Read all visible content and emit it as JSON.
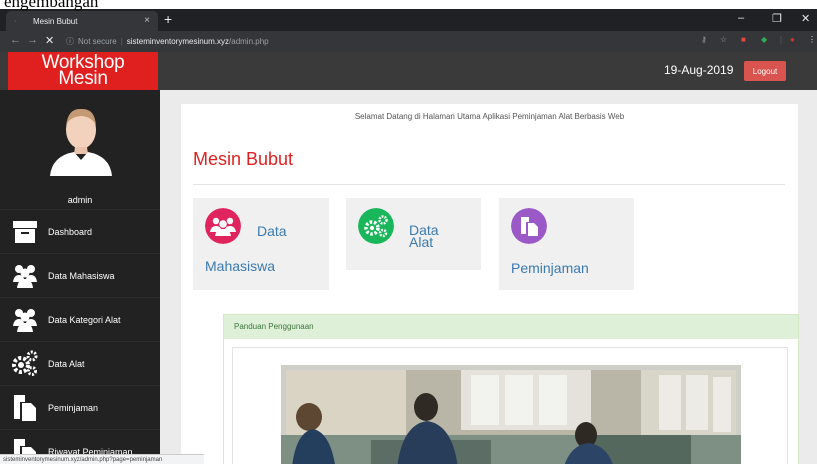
{
  "caption": "engembangan",
  "browser": {
    "tab_title": "Mesin Bubut",
    "tab_close": "×",
    "new_tab": "+",
    "security": "Not secure",
    "url_host": "sisteminventorymesinum.xyz",
    "url_path": "/admin.php"
  },
  "header": {
    "brand_line1": "Workshop",
    "brand_line2": "Mesin",
    "date": "19-Aug-2019",
    "logout": "Logout"
  },
  "sidebar": {
    "user": "admin",
    "items": [
      {
        "label": "Dashboard",
        "icon": "archive-box-icon"
      },
      {
        "label": "Data Mahasiswa",
        "icon": "users-icon"
      },
      {
        "label": "Data Kategori Alat",
        "icon": "users-icon"
      },
      {
        "label": "Data Alat",
        "icon": "gears-icon"
      },
      {
        "label": "Peminjaman",
        "icon": "documents-icon"
      },
      {
        "label": "Riwayat Peminiaman",
        "icon": "documents-icon"
      }
    ]
  },
  "status_url": "sisteminventorymesinum.xyz/admin.php?page=peminjaman",
  "main": {
    "welcome": "Selamat Datang di Halaman Utama Aplikasi Peminjaman Alat Berbasis Web",
    "title": "Mesin Bubut",
    "cards": [
      {
        "line1": "Data",
        "line2": "Mahasiswa",
        "color": "#e0245e"
      },
      {
        "line1": "Data",
        "line2": "Alat",
        "color": "#19b65a"
      },
      {
        "line1": "",
        "line2": "Peminjaman",
        "color": "#9b59c7"
      }
    ],
    "guide_title": "Panduan Penggunaan"
  },
  "colors": {
    "brand_red": "#e01f1f",
    "sidebar_bg": "#222222",
    "header_bg": "#3a3a3a",
    "link_blue": "#3a7ab0",
    "guide_green": "#dff0d8"
  }
}
